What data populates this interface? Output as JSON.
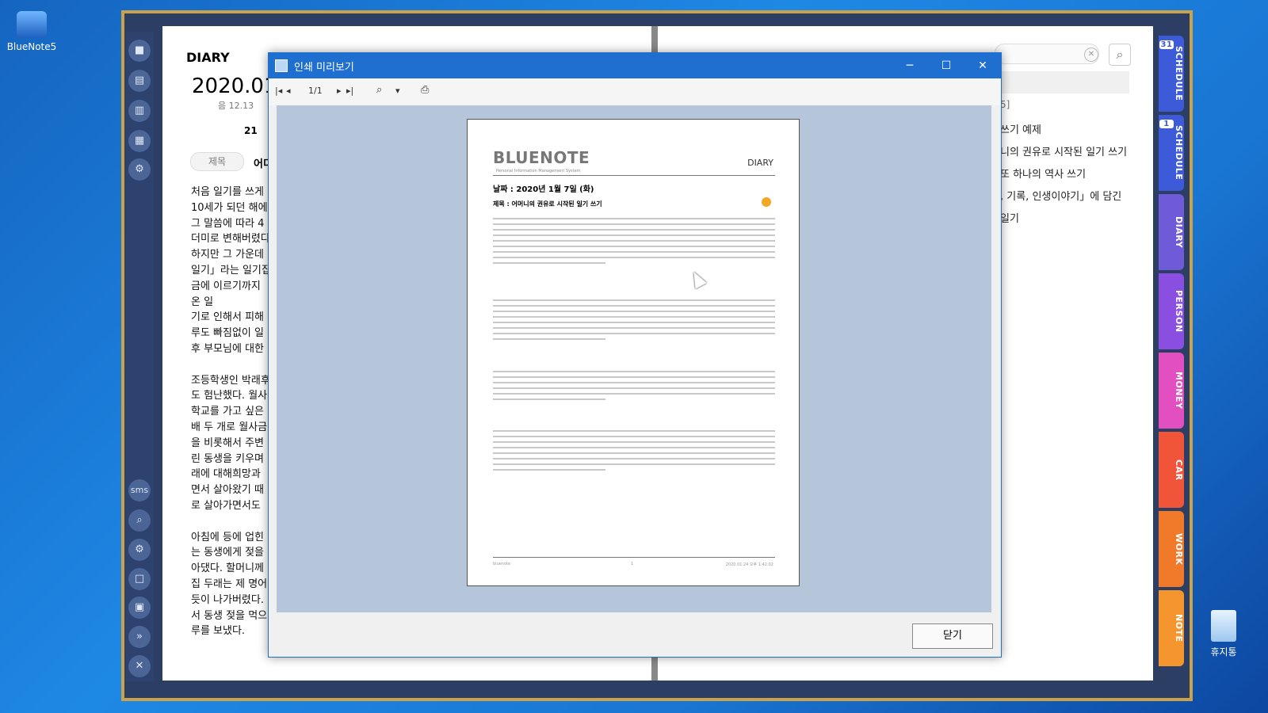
{
  "desktop": {
    "app_icon_label": "BlueNote5",
    "trash_label": "휴지통"
  },
  "rail_icons": [
    "lock-icon",
    "book-icon",
    "book-icon",
    "book-icon",
    "gear-icon",
    "sms-icon",
    "search-icon",
    "gears-icon",
    "square-icon",
    "square-icon",
    "chevron-double-down-icon",
    "close-icon"
  ],
  "rail_sms": "sms",
  "diary": {
    "header": "DIARY",
    "date": "2020.01",
    "lunar": "음 12.13",
    "day": "21",
    "title_tab": "제목",
    "title_tab_trunc": "어디",
    "lines": [
      "처음 일기를 쓰게",
      "10세가 되던 해에",
      "그 말씀에 따라 4",
      "더미로 변해버렸다",
      "하지만 그 가운데",
      "일기」라는 일기집",
      "금에 이르기까지",
      "온 일",
      "기로 인해서 피해",
      "루도 빠짐없이 일",
      "후 부모님에 대한",
      "",
      "조등학생인 박래후",
      "도 험난했다. 월사",
      "학교를 가고 싶은",
      "배 두 개로 월사금",
      "을 비롯해서 주변",
      "린 동생을 키우며",
      "래에 대해희망과",
      "면서 살아왔기 때",
      "로 살아가면서도",
      "",
      "아침에 등에 업힌",
      "는 동생에게 젖을",
      "아댔다. 할머니께",
      "집 두래는 제 명어",
      "듯이 나가버렸다.",
      "서 동생 젖을 먹으",
      "루를 보냈다."
    ]
  },
  "right_page": {
    "count": "5]",
    "items": [
      "쓰기 예제",
      "니의 권유로 시작된 일기 쓰기",
      "또 하나의 역사 쓰기",
      ", 기록, 인생이야기」에 담긴",
      "일기"
    ]
  },
  "side_tabs": [
    {
      "label": "SCHEDULE",
      "badge": "31",
      "color": "#3d5bd8"
    },
    {
      "label": "SCHEDULE",
      "badge": "1",
      "color": "#3d5bd8"
    },
    {
      "label": "DIARY",
      "badge": "",
      "color": "#6f5bd8"
    },
    {
      "label": "PERSON",
      "badge": "",
      "color": "#8a4fe0"
    },
    {
      "label": "MONEY",
      "badge": "",
      "color": "#e24fc0"
    },
    {
      "label": "CAR",
      "badge": "",
      "color": "#f0553a"
    },
    {
      "label": "WORK",
      "badge": "",
      "color": "#f07a2a"
    },
    {
      "label": "NOTE",
      "badge": "",
      "color": "#f5952e"
    }
  ],
  "dialog": {
    "title": "인쇄 미리보기",
    "minimize": "─",
    "maximize": "☐",
    "close": "✕",
    "page_indicator": "1/1",
    "close_button": "닫기"
  },
  "doc": {
    "brand": "BLUENOTE",
    "tagline": "Personal Information Management System",
    "section": "DIARY",
    "date_line": "날짜 : 2020년 1월 7일 (화)",
    "title_line": "제목 : 어머니의 권유로 시작된 일기 쓰기",
    "footer_left": "bluenote",
    "footer_page": "1",
    "footer_right": "2020.01.24 오후 1:42:02"
  },
  "colors": {
    "accent": "#1e6fcf",
    "frame_gold": "#c9a24a",
    "desktop": "#1976d2"
  }
}
